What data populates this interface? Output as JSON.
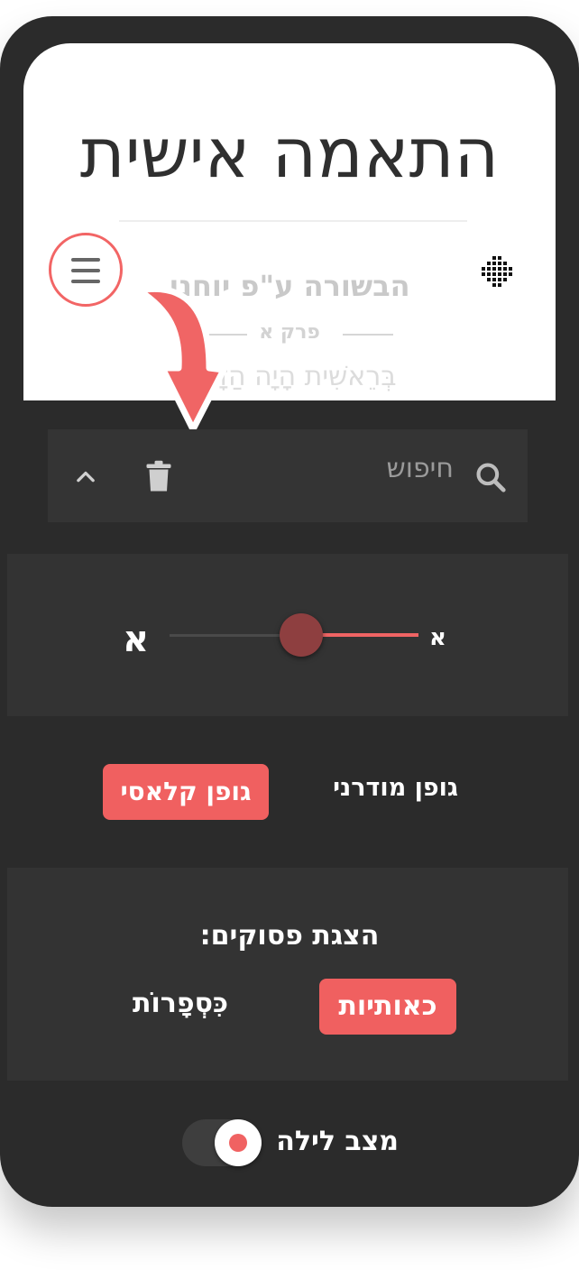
{
  "colors": {
    "accent": "#f06060",
    "panel_bg": "#2b2b2b",
    "section_bg": "#333333",
    "card_bg": "#ffffff"
  },
  "header": {
    "title": "התאמה אישית",
    "book_name": "הבשורה ע\"פ יוחנן",
    "chapter_label": "פרק א",
    "faded_line": "בְּרֵאשִׁית הָיָה הַדָּבָר"
  },
  "icons": {
    "menu": "hamburger-menu-icon",
    "grid": "grid-icon",
    "search": "search-icon",
    "trash": "trash-icon",
    "collapse": "chevron-up-icon",
    "arrow": "curved-arrow-pointer"
  },
  "search": {
    "placeholder": "חיפוש"
  },
  "font_size": {
    "min_label": "א",
    "max_label": "א",
    "level": 0.47
  },
  "font_family": {
    "classic_label": "גופן קלאסי",
    "modern_label": "גופן מודרני",
    "selected": "classic"
  },
  "verse_display": {
    "title": "הצגת פסוקים:",
    "letters_label": "כאותיות",
    "numbers_label": "כִּסְפָרוֹת",
    "selected": "letters"
  },
  "night_mode": {
    "label": "מצב לילה",
    "on": true
  }
}
